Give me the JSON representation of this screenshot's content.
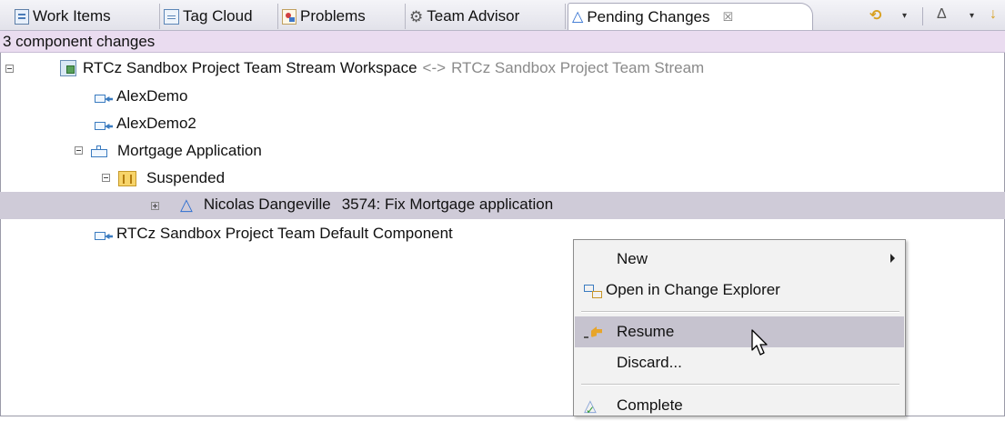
{
  "tabs": [
    {
      "label": "Work Items",
      "icon": "work-items-icon"
    },
    {
      "label": "Tag Cloud",
      "icon": "tag-cloud-icon"
    },
    {
      "label": "Problems",
      "icon": "problems-icon"
    },
    {
      "label": "Team Advisor",
      "icon": "gear-icon"
    },
    {
      "label": "Pending Changes",
      "icon": "pending-changes-icon",
      "active": true,
      "close": "☒"
    }
  ],
  "toolbar": {
    "sync_icon": "sync-icon",
    "delta_icon": "delta-icon",
    "dropdown_glyph": "▾"
  },
  "status": "3 component changes",
  "tree": {
    "workspace": {
      "name": "RTCz Sandbox Project Team Stream Workspace",
      "arrow": "<->",
      "stream": "RTCz Sandbox Project Team Stream"
    },
    "components": [
      {
        "name": "AlexDemo"
      },
      {
        "name": "AlexDemo2"
      },
      {
        "name": "Mortgage Application"
      },
      {
        "name": "RTCz Sandbox Project Team Default Component"
      }
    ],
    "suspended_folder": "Suspended",
    "change_set": {
      "author": "Nicolas Dangeville",
      "summary": "3574: Fix Mortgage application"
    }
  },
  "context_menu": {
    "items": [
      {
        "label": "New",
        "submenu": true
      },
      {
        "label": "Open in Change Explorer"
      },
      {
        "label": "Resume",
        "highlighted": true
      },
      {
        "label": "Discard..."
      },
      {
        "label": "Complete"
      }
    ]
  }
}
